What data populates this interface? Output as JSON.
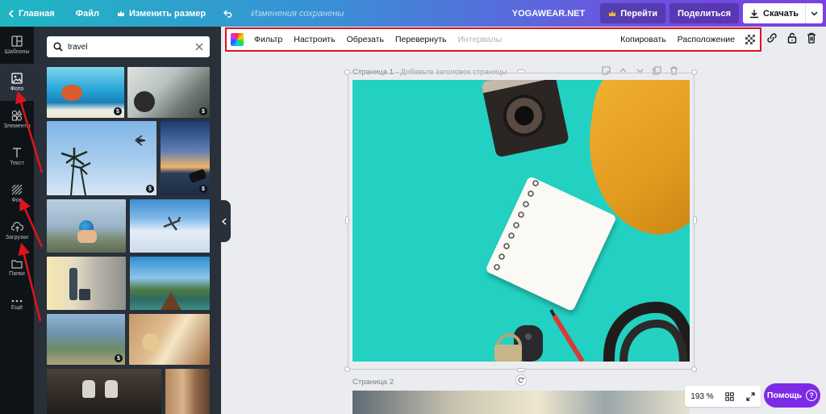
{
  "topbar": {
    "home": "Главная",
    "file": "Файл",
    "resize": "Изменить размер",
    "saved_status": "Изменения сохранены",
    "project_name": "YOGAWEAR.NET",
    "go": "Перейти",
    "share": "Поделиться",
    "download": "Скачать"
  },
  "nav": {
    "templates": "Шаблоны",
    "photos": "Фото",
    "elements": "Элементы",
    "text": "Текст",
    "background": "Фон",
    "uploads": "Загрузки",
    "folders": "Папки",
    "more": "Ещё"
  },
  "search": {
    "value": "travel"
  },
  "paid_badge": "$",
  "edit_toolbar": {
    "filter": "Фильтр",
    "adjust": "Настроить",
    "crop": "Обрезать",
    "flip": "Перевернуть",
    "spacing": "Интервалы",
    "copy": "Копировать",
    "position": "Расположение"
  },
  "canvas": {
    "page1": "Страница 1",
    "page1_hint": " - Добавьте заголовок страницы",
    "page2": "Страница 2"
  },
  "zoom": {
    "level": "193 %"
  },
  "help": {
    "label": "Помощь",
    "icon": "?"
  },
  "colors": {
    "accent": "#7d2ae8",
    "highlight": "#e1131b",
    "artwork_bg": "#23d1c2"
  }
}
